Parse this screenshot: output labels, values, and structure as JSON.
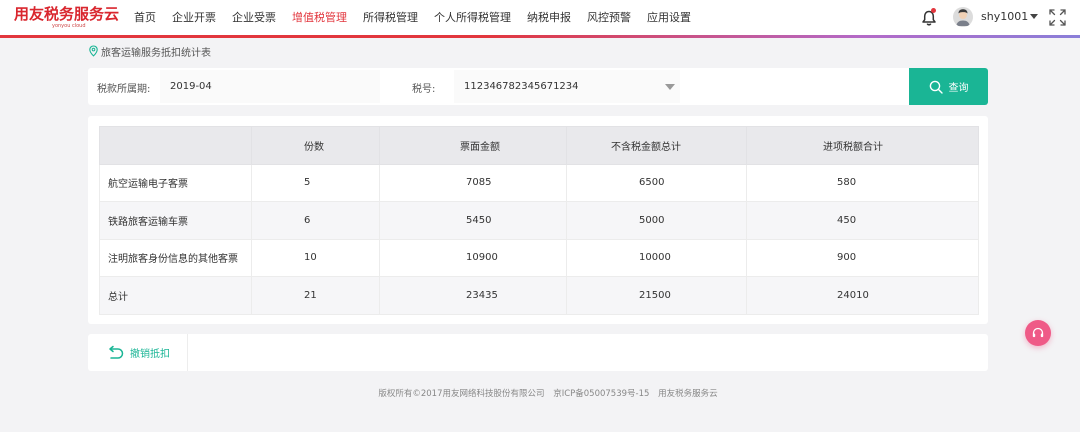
{
  "brand": {
    "name": "用友税务服务云",
    "sub": "yonyou cloud"
  },
  "nav": {
    "items": [
      {
        "label": "首页"
      },
      {
        "label": "企业开票"
      },
      {
        "label": "企业受票"
      },
      {
        "label": "增值税管理",
        "active": true
      },
      {
        "label": "所得税管理"
      },
      {
        "label": "个人所得税管理"
      },
      {
        "label": "纳税申报"
      },
      {
        "label": "风控预警"
      },
      {
        "label": "应用设置"
      }
    ]
  },
  "user": {
    "name": "shy1001"
  },
  "breadcrumb": {
    "title": "旅客运输服务抵扣统计表"
  },
  "filter": {
    "period_label": "税款所属期:",
    "period_value": "2019-04",
    "tax_label": "税号:",
    "tax_value": "112346782345671234",
    "query_label": "查询"
  },
  "table": {
    "headers": [
      "",
      "份数",
      "票面金额",
      "不含税金额总计",
      "进项税额合计"
    ],
    "rows": [
      [
        "航空运输电子客票",
        "5",
        "7085",
        "6500",
        "580"
      ],
      [
        "铁路旅客运输车票",
        "6",
        "5450",
        "5000",
        "450"
      ],
      [
        "注明旅客身份信息的其他客票",
        "10",
        "10900",
        "10000",
        "900"
      ],
      [
        "总计",
        "21",
        "23435",
        "21500",
        "24010"
      ]
    ]
  },
  "actions": {
    "cancel_deduction": "撤销抵扣"
  },
  "footer": {
    "copyright": "版权所有©2017用友网络科技股份有限公司",
    "icp": "京ICP备05007539号-15",
    "brand": "用友税务服务云"
  },
  "colors": {
    "brand_red": "#e2363d",
    "accent_green": "#1ab595",
    "float_pink": "#ef5a87"
  },
  "icons": {
    "bell": "bell-icon",
    "fullscreen": "fullscreen-icon",
    "location": "location-pin-icon",
    "search": "search-icon",
    "undo": "undo-icon",
    "headset": "headset-icon"
  }
}
